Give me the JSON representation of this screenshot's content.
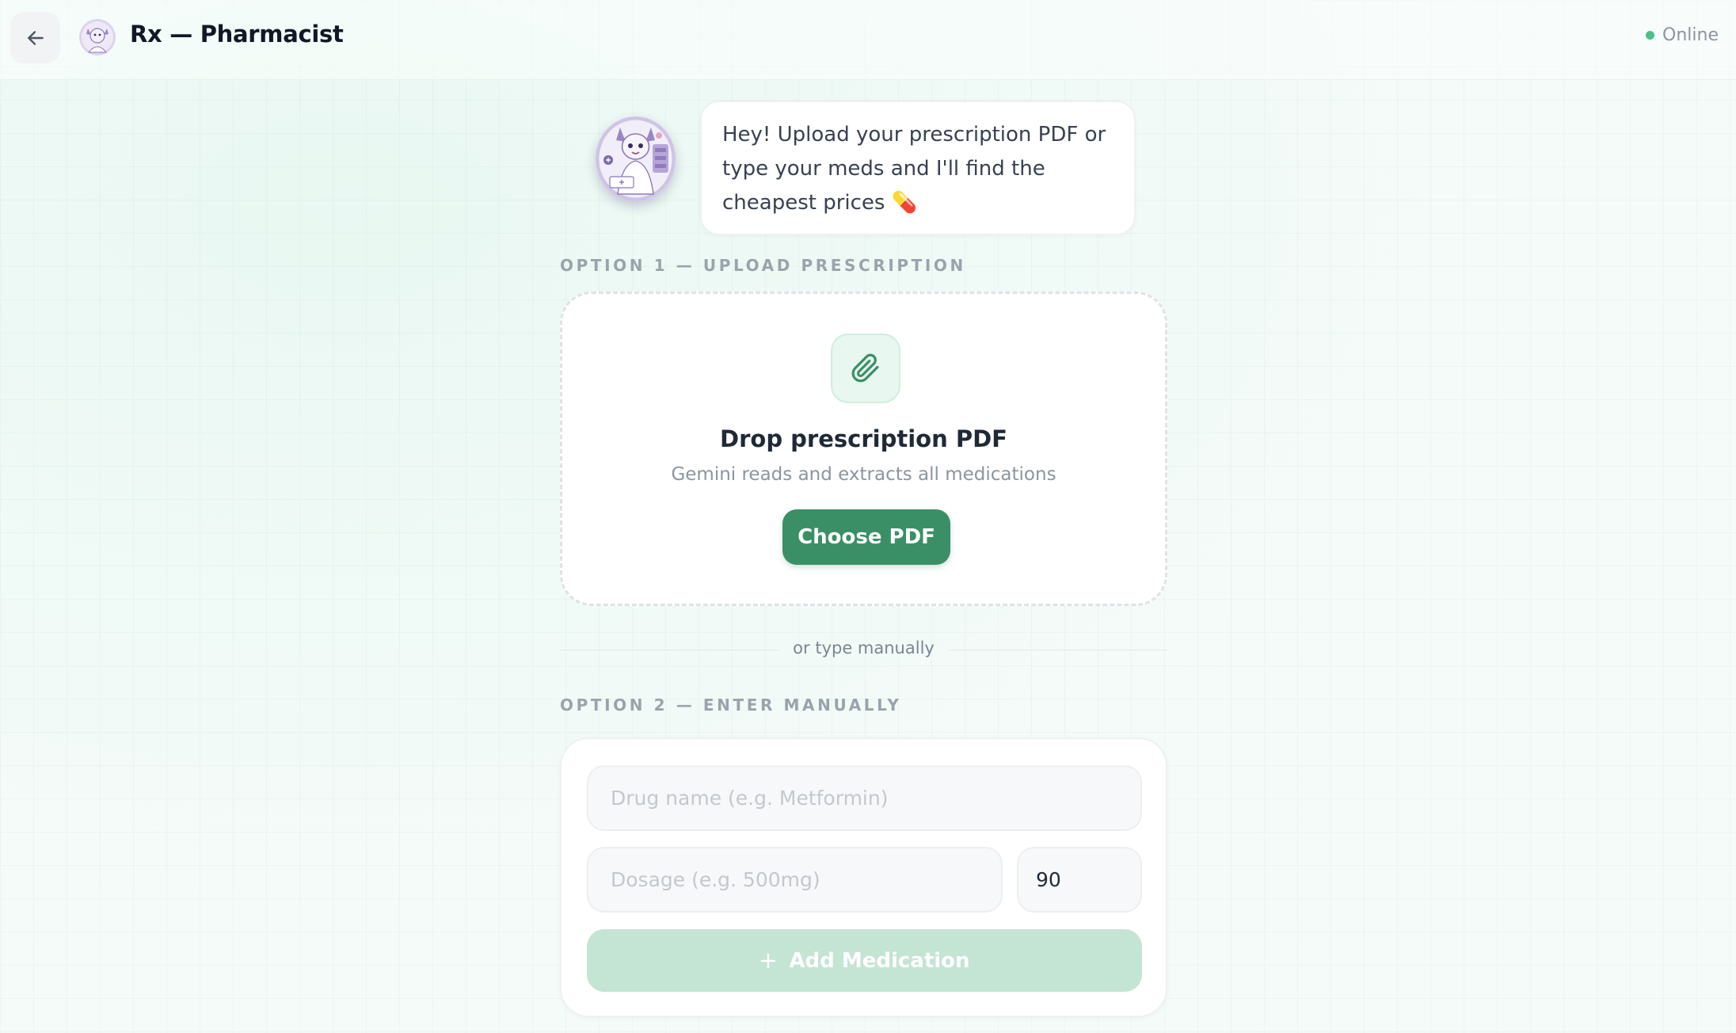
{
  "header": {
    "back_icon": "arrow-left-icon",
    "title": "Rx — Pharmacist",
    "status": "Online",
    "status_color": "#4cc08a"
  },
  "chat": {
    "message": "Hey! Upload your prescription PDF or type your meds and I'll find the cheapest prices 💊"
  },
  "upload": {
    "section_label": "OPTION 1 — UPLOAD PRESCRIPTION",
    "icon": "paperclip-icon",
    "title": "Drop prescription PDF",
    "subtitle": "Gemini reads and extracts all medications",
    "button_label": "Choose PDF"
  },
  "divider": {
    "text": "or type manually"
  },
  "manual": {
    "section_label": "OPTION 2 — ENTER MANUALLY",
    "drug_placeholder": "Drug name (e.g. Metformin)",
    "drug_value": "",
    "dosage_placeholder": "Dosage (e.g. 500mg)",
    "dosage_value": "",
    "quantity_value": "90",
    "add_button_label": "Add Medication",
    "add_icon": "plus-icon"
  },
  "colors": {
    "accent": "#3a8f66",
    "accent_disabled": "#c4e4d4",
    "accent_light": "#e8f7ef"
  }
}
